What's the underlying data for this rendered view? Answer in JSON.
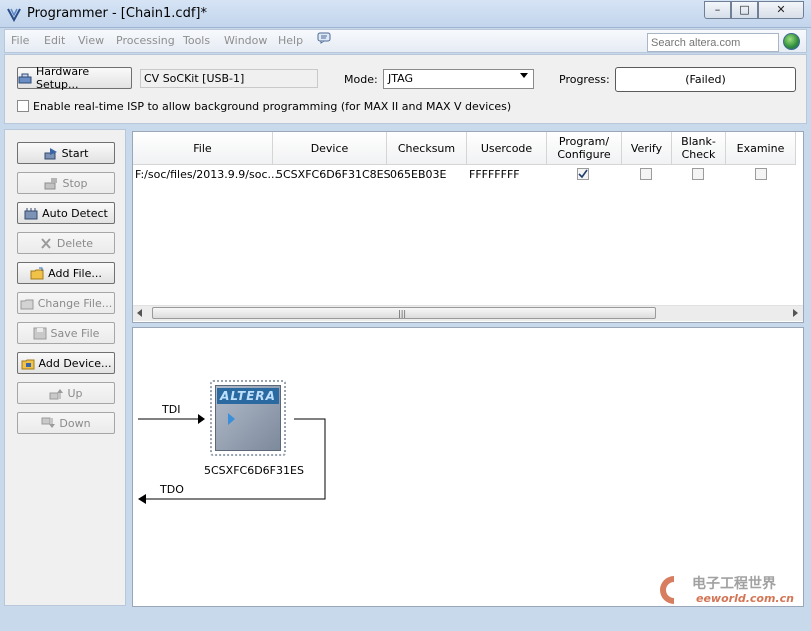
{
  "window": {
    "title": "Programmer - [Chain1.cdf]*",
    "controls": [
      "minimize",
      "maximize",
      "close"
    ]
  },
  "menu": {
    "items": [
      "File",
      "Edit",
      "View",
      "Processing",
      "Tools",
      "Window",
      "Help"
    ],
    "search_placeholder": "Search altera.com"
  },
  "toolbar": {
    "hardware_button": "Hardware Setup...",
    "hardware_value": "CV SoCKit [USB-1]",
    "mode_label": "Mode:",
    "mode_value": "JTAG",
    "progress_label": "Progress:",
    "progress_value": "(Failed)",
    "isp_checkbox_label": "Enable real-time ISP to allow background programming (for MAX II and MAX V devices)",
    "isp_checked": false
  },
  "sidebar": {
    "buttons": [
      {
        "label": "Start",
        "icon": "start-icon",
        "enabled": true
      },
      {
        "label": "Stop",
        "icon": "stop-icon",
        "enabled": false
      },
      {
        "label": "Auto Detect",
        "icon": "auto-detect-icon",
        "enabled": true
      },
      {
        "label": "Delete",
        "icon": "delete-icon",
        "enabled": false
      },
      {
        "label": "Add File...",
        "icon": "add-file-icon",
        "enabled": true
      },
      {
        "label": "Change File...",
        "icon": "change-file-icon",
        "enabled": false
      },
      {
        "label": "Save File",
        "icon": "save-file-icon",
        "enabled": false
      },
      {
        "label": "Add Device...",
        "icon": "add-device-icon",
        "enabled": true
      },
      {
        "label": "Up",
        "icon": "up-icon",
        "enabled": false
      },
      {
        "label": "Down",
        "icon": "down-icon",
        "enabled": false
      }
    ]
  },
  "table": {
    "columns": [
      "File",
      "Device",
      "Checksum",
      "Usercode",
      "Program/\nConfigure",
      "Verify",
      "Blank-\nCheck",
      "Examine"
    ],
    "rows": [
      {
        "file": "F:/soc/files/2013.9.9/soc...",
        "device": "5CSXFC6D6F31C8ES",
        "checksum": "065EB03E",
        "usercode": "FFFFFFFF",
        "program_configure": true,
        "verify": false,
        "blank_check": false,
        "examine": false
      }
    ]
  },
  "chain": {
    "device_name": "5CSXFC6D6F31ES",
    "vendor_logo_text": "ALTERA",
    "tdi_label": "TDI",
    "tdo_label": "TDO"
  },
  "watermark": {
    "brand_text": "电子工程世界",
    "site_text": "eeworld.com.cn"
  },
  "colors": {
    "window_frame": "#c9d9ec",
    "panel_bg": "#f0f0f0",
    "altera_blue": "#2a6aa0"
  }
}
